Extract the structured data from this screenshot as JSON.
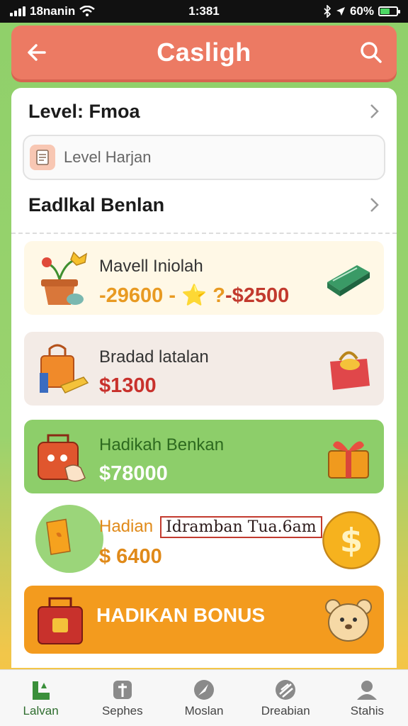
{
  "status_bar": {
    "carrier": "18nanin",
    "time": "1:381",
    "battery": "60%",
    "battery_level": 0.6
  },
  "header": {
    "title": "Casligh",
    "back_icon": "arrow-left-icon",
    "search_icon": "search-icon"
  },
  "menu": {
    "level_link": "Level: Fmoa",
    "level_field": "Level Harjan",
    "section_link": "Eadlkal Benlan"
  },
  "cards": [
    {
      "title": "Mavell Iniolah",
      "amount": "-29600 - ⭐ ?",
      "amount_tail": "-$2500"
    },
    {
      "title": "Bradad latalan",
      "amount": "$1300"
    },
    {
      "title": "Hadikah Benkan",
      "amount": "$78000"
    },
    {
      "title": "Hadian",
      "tag": "Idramban Tua.6am",
      "amount": "$ 6400"
    },
    {
      "title": "HADIKAN BONUS"
    }
  ],
  "tabs": [
    {
      "label": "Lalvan",
      "icon": "home-icon",
      "active": true
    },
    {
      "label": "Sephes",
      "icon": "book-icon",
      "active": false
    },
    {
      "label": "Moslan",
      "icon": "compass-icon",
      "active": false
    },
    {
      "label": "Dreabian",
      "icon": "map-icon",
      "active": false
    },
    {
      "label": "Stahis",
      "icon": "profile-icon",
      "active": false
    }
  ],
  "colors": {
    "header": "#ec7a63",
    "accent_green": "#8dce6a",
    "bonus_orange": "#f39b1e"
  }
}
